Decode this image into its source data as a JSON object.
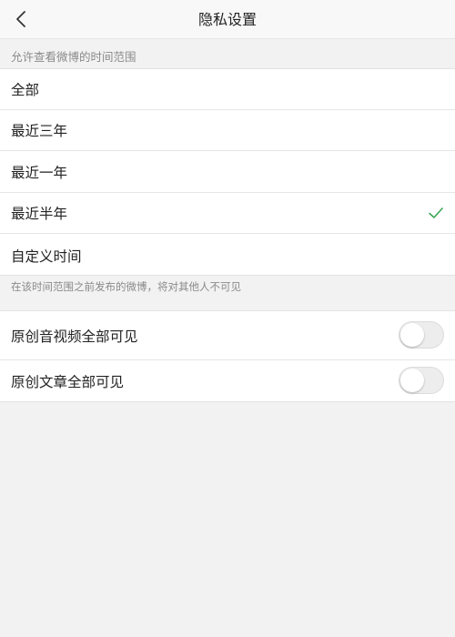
{
  "nav": {
    "title": "隐私设置",
    "back_icon": "chevron-left-icon"
  },
  "visibility": {
    "header": "允许查看微博的时间范围",
    "options": [
      {
        "label": "全部",
        "selected": false
      },
      {
        "label": "最近三年",
        "selected": false
      },
      {
        "label": "最近一年",
        "selected": false
      },
      {
        "label": "最近半年",
        "selected": true
      },
      {
        "label": "自定义时间",
        "selected": false
      }
    ],
    "footnote": "在该时间范围之前发布的微博，将对其他人不可见",
    "check_color": "#3aa856"
  },
  "toggles": [
    {
      "label": "原创音视频全部可见",
      "on": false
    },
    {
      "label": "原创文章全部可见",
      "on": false
    }
  ]
}
